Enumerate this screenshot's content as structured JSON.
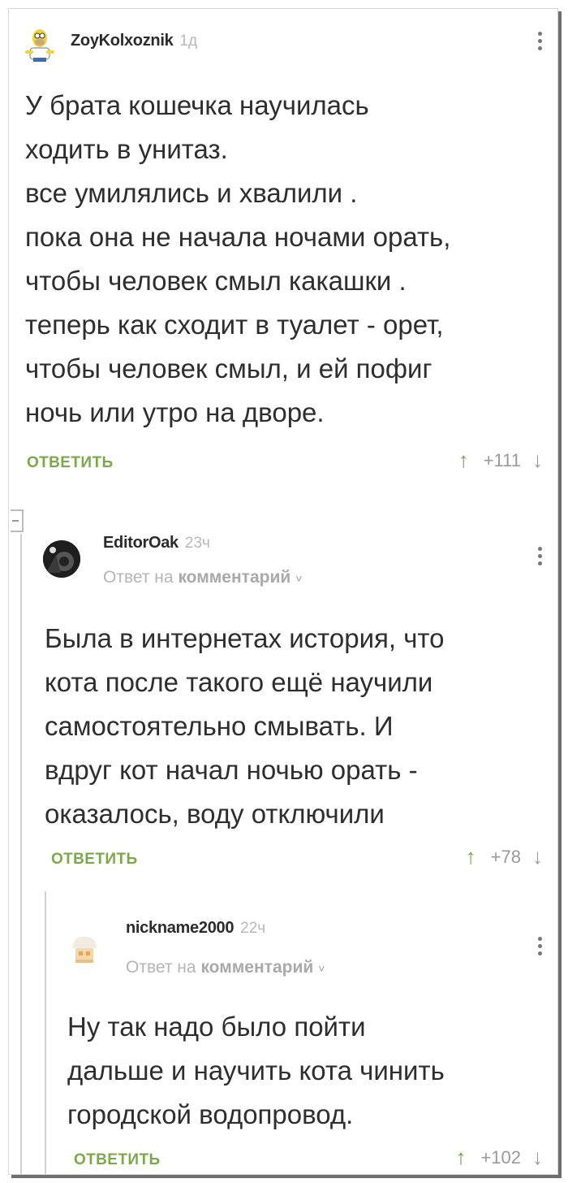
{
  "colors": {
    "accent_green": "#7aa94a",
    "upvote": "#6ea83e",
    "muted": "#b5b5b5"
  },
  "comments": [
    {
      "nick": "ZoyKolxoznik",
      "time": "1д",
      "avatar_icon": "homer-simpson-avatar",
      "text": "У брата кошечка научилась\nходить в унитаз.\nвсе умилялись и хвалили .\nпока она не начала ночами орать,\nчтобы человек смыл какашки .\nтеперь как сходит в туалет - орет,\nчтобы человек смыл, и ей пофиг\nночь или утро на дворе.",
      "reply_label": "ОТВЕТИТЬ",
      "up": "↑",
      "score": "+111",
      "down": "↓"
    },
    {
      "nick": "EditorOak",
      "time": "23ч",
      "avatar_icon": "dark-photo-avatar",
      "reply_prefix": "Ответ на",
      "reply_target": "комментарий",
      "text": "Была в интернетах история, что\nкота после такого ещё научили\nсамостоятельно смывать. И\nвдруг кот начал ночью орать -\nоказалось, воду отключили",
      "reply_label": "ОТВЕТИТЬ",
      "up": "↑",
      "score": "+78",
      "down": "↓"
    },
    {
      "nick": "nickname2000",
      "time": "22ч",
      "avatar_icon": "default-avatar",
      "reply_prefix": "Ответ на",
      "reply_target": "комментарий",
      "text": "Ну так надо было пойти\nдальше и научить кота чинить\nгородской водопровод.",
      "reply_label": "ОТВЕТИТЬ",
      "up": "↑",
      "score": "+102",
      "down": "↓"
    }
  ]
}
